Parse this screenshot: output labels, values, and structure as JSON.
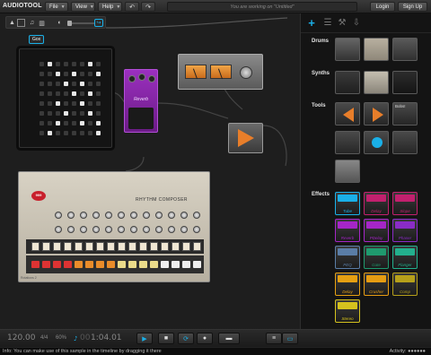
{
  "app": {
    "logo": "AUDIOTOOL"
  },
  "topbar": {
    "menus": [
      {
        "label": "File"
      },
      {
        "label": "View"
      },
      {
        "label": "Help"
      }
    ],
    "undo_icon": "undo-arrow-icon",
    "redo_icon": "redo-arrow-icon",
    "working_text": "You are working on \"Untitled\"",
    "login_label": "Login",
    "signup_label": "Sign Up"
  },
  "canvas": {
    "toolstrip_icons": [
      "select-arrow-icon",
      "grid-icon",
      "headphones-icon",
      "piano-keys-icon",
      "volume-icon"
    ],
    "tooltip": "Gox",
    "pedal_label": "Reverb",
    "drum_machine_title": "RHYTHM COMPOSER",
    "drum_machine_brand": "909",
    "drum_machine_caption": "Rotations 2"
  },
  "sidebar": {
    "tabs": [
      "add-plus-icon",
      "menu-list-icon",
      "wrench-icon",
      "download-icon"
    ],
    "categories": {
      "drums": "Drums",
      "synths": "Synths",
      "tools": "Tools",
      "effects": "Effects"
    },
    "tools": {
      "bobs": "Bobs!"
    },
    "effects": [
      {
        "label": "Tube",
        "color": "#1ab0e8"
      },
      {
        "label": "Delay",
        "color": "#c2206e"
      },
      {
        "label": "Slope",
        "color": "#c2206e"
      },
      {
        "label": "Reverb",
        "color": "#a526c7"
      },
      {
        "label": "PDelay",
        "color": "#a526c7"
      },
      {
        "label": "Phaser",
        "color": "#8a2cc6"
      },
      {
        "label": "PEQ",
        "color": "#5a7da6"
      },
      {
        "label": "Gate",
        "color": "#1f9a6e"
      },
      {
        "label": "Flanger",
        "color": "#23b08d"
      },
      {
        "label": "Delay",
        "color": "#e6a012"
      },
      {
        "label": "Crusher",
        "color": "#e69c12"
      },
      {
        "label": "Comp",
        "color": "#b6a01a"
      },
      {
        "label": "Stereo",
        "color": "#d4c21e"
      }
    ]
  },
  "transport": {
    "bpm": "120.00",
    "signature": "4/4",
    "zoom": "60%",
    "time_prefix": "00",
    "time": "1:04.01",
    "play_icon": "play-icon",
    "stop_icon": "stop-icon",
    "loop_icon": "loop-icon",
    "record_icon": "record-icon"
  },
  "info": {
    "text": "Info: You can make use of this sample in the timeline by dragging it there",
    "activity_label": "Activity:",
    "activity_value": "●●●●●●"
  }
}
